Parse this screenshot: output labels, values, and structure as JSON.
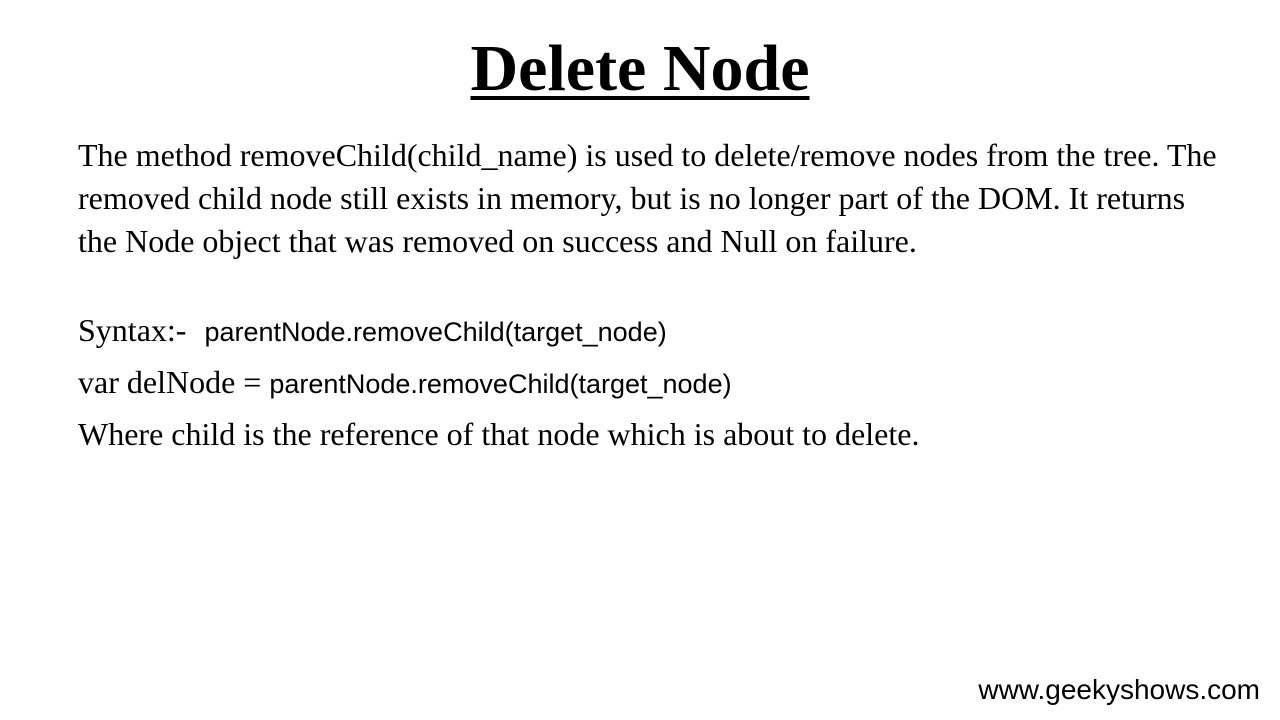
{
  "slide": {
    "title": "Delete Node",
    "description": "The method removeChild(child_name) is used to delete/remove nodes from the tree. The removed child node still exists in memory, but is no longer part of the DOM. It returns the Node object that was removed on success and Null on failure.",
    "syntax_label": "Syntax:-",
    "syntax_code": "parentNode.removeChild(target_node)",
    "example_prefix": "var delNode = ",
    "example_code": "parentNode.removeChild(target_node)",
    "note": "Where child is the reference of that node which is about to delete."
  },
  "footer": {
    "website": "www.geekyshows.com"
  }
}
